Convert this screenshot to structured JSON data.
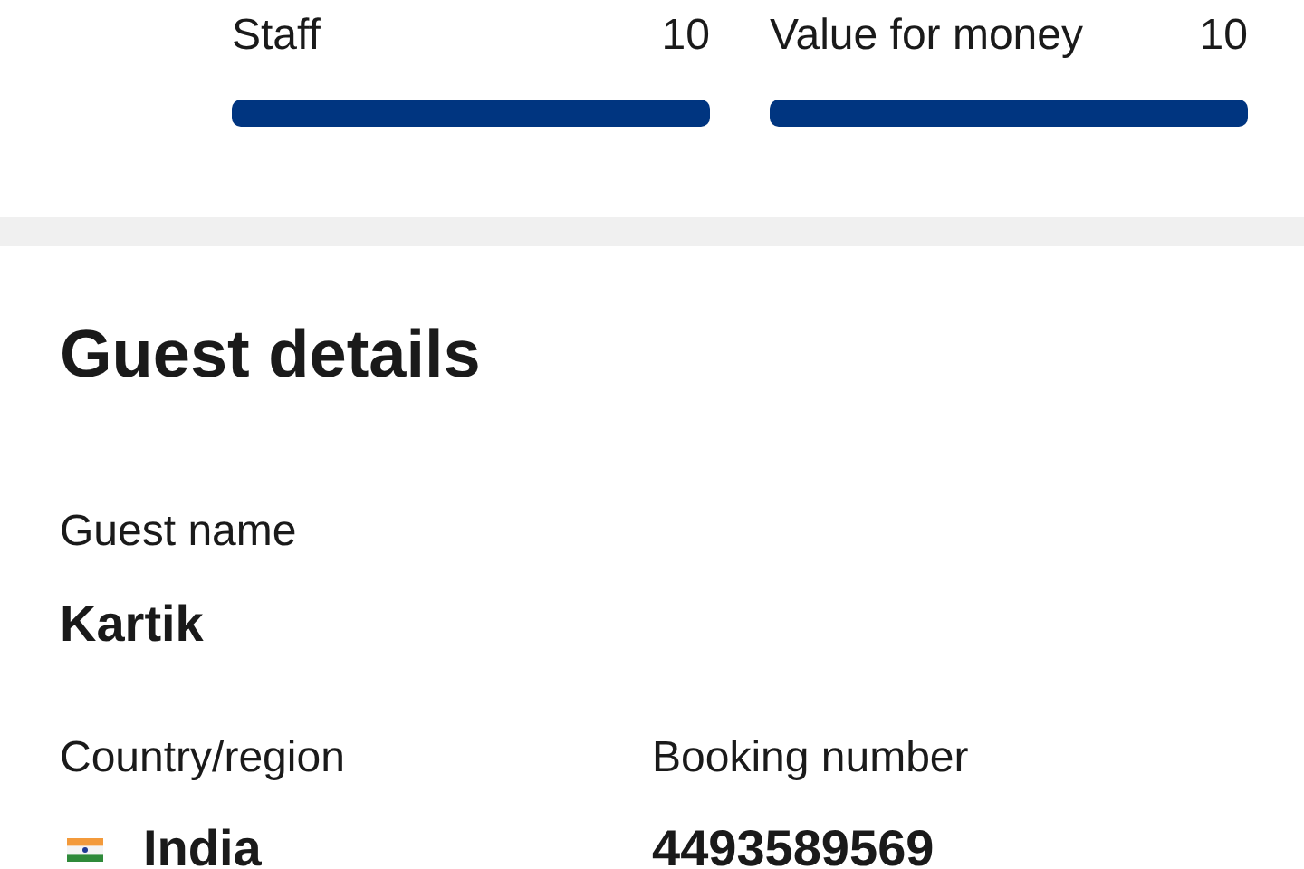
{
  "ratings": [
    {
      "label": "Staff",
      "score": "10",
      "level": 1
    },
    {
      "label": "Value for money",
      "score": "10",
      "level": 1
    }
  ],
  "guest_details": {
    "title": "Guest details",
    "guest_name": {
      "label": "Guest name",
      "value": "Kartik"
    },
    "country": {
      "label": "Country/region",
      "value": "India"
    },
    "booking": {
      "label": "Booking number",
      "value": "4493589569"
    }
  }
}
